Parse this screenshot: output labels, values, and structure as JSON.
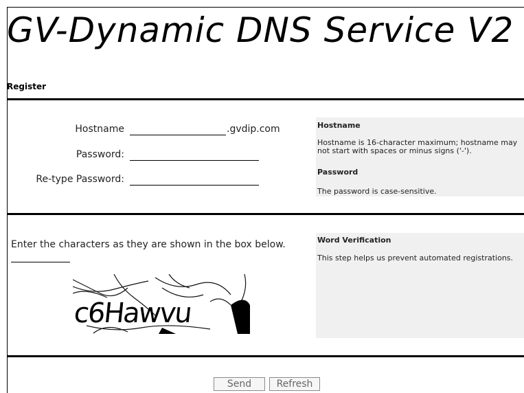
{
  "header": {
    "title": "GV-Dynamic DNS Service V2",
    "section": "Register"
  },
  "form": {
    "hostname_label": "Hostname",
    "hostname_value": "",
    "hostname_suffix": ".gvdip.com",
    "password_label": "Password:",
    "password_value": "",
    "retype_label": "Re-type Password:",
    "retype_value": ""
  },
  "help": {
    "hostname_title": "Hostname",
    "hostname_text": "Hostname is 16-character maximum; hostname may not start with spaces or minus signs ('-').",
    "password_title": "Password",
    "password_text": "The password is case-sensitive."
  },
  "verification": {
    "instruction": "Enter the characters as they are shown in the box below.",
    "value": "",
    "captcha_text": "c6Hawvu",
    "title": "Word Verification",
    "text": "This step helps us prevent automated registrations."
  },
  "buttons": {
    "send": "Send",
    "refresh": "Refresh"
  }
}
